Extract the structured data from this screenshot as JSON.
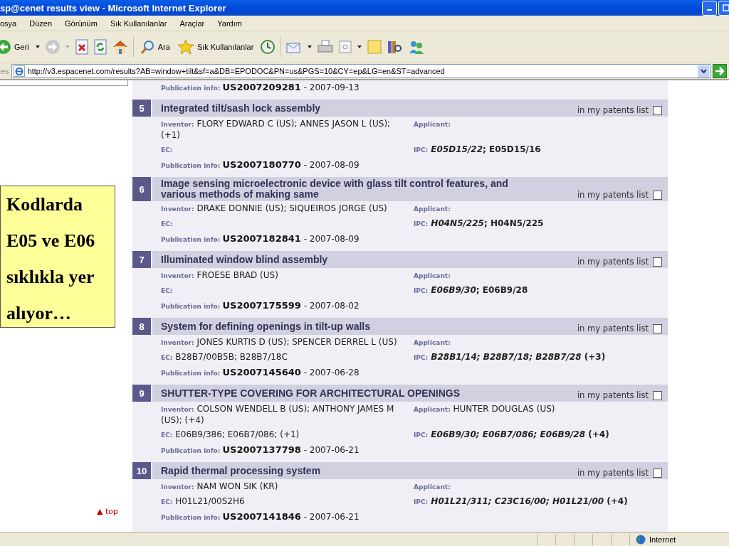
{
  "window": {
    "title": "sp@cenet results view - Microsoft Internet Explorer"
  },
  "menu": [
    "osya",
    "Düzen",
    "Görünüm",
    "Sık Kullanılanlar",
    "Araçlar",
    "Yardım"
  ],
  "toolbar": {
    "back": "Geri",
    "search": "Ara",
    "favorites": "Sık Kullanılanlar"
  },
  "address": {
    "label": "es",
    "url": "http://v3.espacenet.com/results?AB=window+tilt&sf=a&DB=EPODOC&PN=us&PGS=10&CY=ep&LG=en&ST=advanced"
  },
  "date_separator": "-",
  "partial_row": {
    "label": "Publication info:",
    "number": "US2007209281",
    "date": "2007-09-13"
  },
  "results": [
    {
      "number": "5",
      "title": "Integrated tilt/sash lock assembly",
      "list_label": "in my patents list",
      "checked": false,
      "fields": [
        {
          "kind": "inventor",
          "label": "Inventor:",
          "value": "FLORY EDWARD C (US); ANNES JASON L (US); (+1)"
        },
        {
          "kind": "applicant",
          "label": "Applicant:"
        },
        {
          "kind": "ec",
          "label": "EC:"
        },
        {
          "kind": "ipc",
          "label": "IPC:",
          "value": "*E05D15/22*; E05D15/16"
        },
        {
          "kind": "publication",
          "label": "Publication info:",
          "number": "US2007180770",
          "date": "2007-08-09"
        }
      ]
    },
    {
      "number": "6",
      "title": "Image sensing microelectronic device with glass tilt control features, and various methods of making same",
      "list_label": "in my patents list",
      "checked": false,
      "fields": [
        {
          "kind": "inventor",
          "label": "Inventor:",
          "value": "DRAKE DONNIE (US); SIQUEIROS JORGE (US)"
        },
        {
          "kind": "applicant",
          "label": "Applicant:"
        },
        {
          "kind": "ec",
          "label": "EC:"
        },
        {
          "kind": "ipc",
          "label": "IPC:",
          "value": "*H04N5/225*; H04N5/225"
        },
        {
          "kind": "publication",
          "label": "Publication info:",
          "number": "US2007182841",
          "date": "2007-08-09"
        }
      ]
    },
    {
      "number": "7",
      "title": "Illuminated window blind assembly",
      "list_label": "in my patents list",
      "checked": false,
      "fields": [
        {
          "kind": "inventor",
          "label": "Inventor:",
          "value": "FROESE BRAD (US)"
        },
        {
          "kind": "applicant",
          "label": "Applicant:"
        },
        {
          "kind": "ec",
          "label": "EC:"
        },
        {
          "kind": "ipc",
          "label": "IPC:",
          "value": "*E06B9/30*; E06B9/28"
        },
        {
          "kind": "publication",
          "label": "Publication info:",
          "number": "US2007175599",
          "date": "2007-08-02"
        }
      ]
    },
    {
      "number": "8",
      "title": "System for defining openings in tilt-up walls",
      "list_label": "in my patents list",
      "checked": false,
      "fields": [
        {
          "kind": "inventor",
          "label": "Inventor:",
          "value": "JONES KURTIS D (US); SPENCER DERREL L (US)"
        },
        {
          "kind": "applicant",
          "label": "Applicant:"
        },
        {
          "kind": "ec",
          "label": "EC:",
          "value": "B28B7/00B5B; B28B7/18C"
        },
        {
          "kind": "ipc",
          "label": "IPC:",
          "value": "*B28B1/14; B28B7/18; B28B7/28* (+3)"
        },
        {
          "kind": "publication",
          "label": "Publication info:",
          "number": "US2007145640",
          "date": "2007-06-28"
        }
      ]
    },
    {
      "number": "9",
      "title": "SHUTTER-TYPE COVERING FOR ARCHITECTURAL OPENINGS",
      "list_label": "in my patents list",
      "checked": false,
      "fields": [
        {
          "kind": "inventor",
          "label": "Inventor:",
          "value": "COLSON WENDELL B (US); ANTHONY JAMES M (US); (+4)"
        },
        {
          "kind": "applicant",
          "label": "Applicant:",
          "value": "HUNTER DOUGLAS (US)"
        },
        {
          "kind": "ec",
          "label": "EC:",
          "value": "E06B9/386; E06B7/086; (+1)"
        },
        {
          "kind": "ipc",
          "label": "IPC:",
          "value": "*E06B9/30; E06B7/086; E06B9/28* (+4)"
        },
        {
          "kind": "publication",
          "label": "Publication info:",
          "number": "US2007137798",
          "date": "2007-06-21"
        }
      ]
    },
    {
      "number": "10",
      "title": "Rapid thermal processing system",
      "list_label": "in my patents list",
      "checked": false,
      "fields": [
        {
          "kind": "inventor",
          "label": "Inventor:",
          "value": "NAM WON SIK (KR)"
        },
        {
          "kind": "applicant",
          "label": "Applicant:"
        },
        {
          "kind": "ec",
          "label": "EC:",
          "value": "H01L21/00S2H6"
        },
        {
          "kind": "ipc",
          "label": "IPC:",
          "value": "*H01L21/311; C23C16/00; H01L21/00* (+4)"
        },
        {
          "kind": "publication",
          "label": "Publication info:",
          "number": "US2007141846",
          "date": "2007-06-21"
        }
      ]
    }
  ],
  "top_link": "▲ top",
  "note": {
    "lines": [
      "Kodlarda",
      "E05 ve E06",
      "sıklıkla yer",
      "alıyor…"
    ]
  },
  "status_bar": {
    "zone": "Internet"
  }
}
